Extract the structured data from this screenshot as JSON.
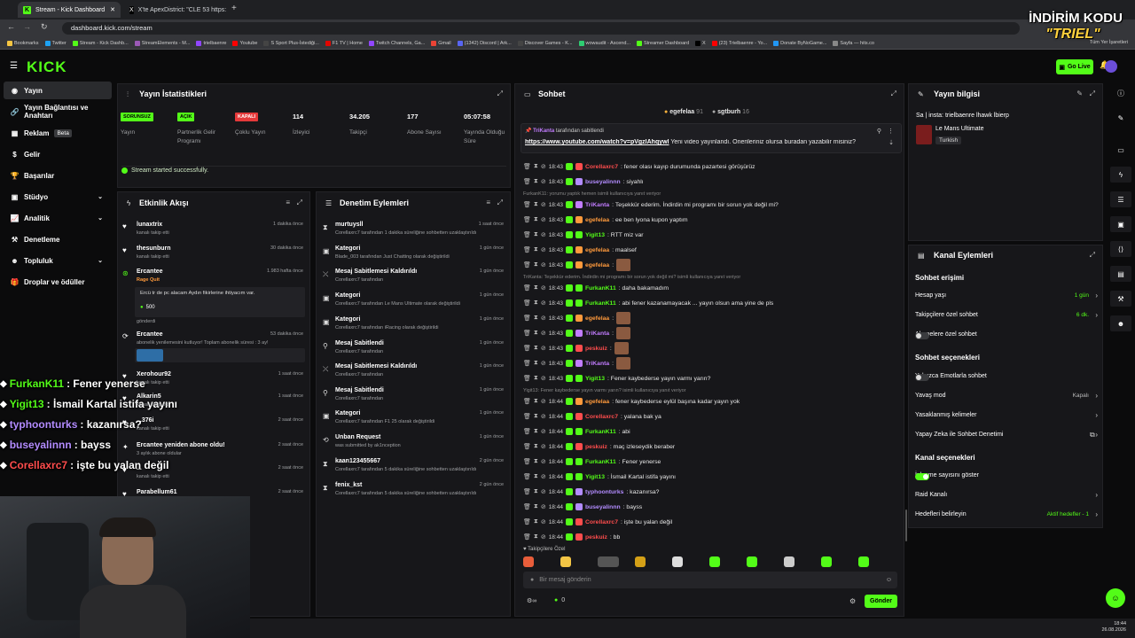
{
  "browser": {
    "tabs": [
      {
        "title": "Stream - Kick Dashboard",
        "icon": "kick-icon"
      },
      {
        "title": "X'te ApexDistrict: \"CLE 53 https:",
        "icon": "x-icon"
      }
    ],
    "url": "dashboard.kick.com/stream",
    "bookmarks": [
      "Bookmarks",
      "Twitter",
      "Stream - Kick Dashb...",
      "StreamElements - M...",
      "trielbaenre",
      "Youtube",
      "S Sport Plus-İstediği...",
      "F1 TV | Home",
      "Twitch Channels, Ga...",
      "Gmail",
      "(1342) Discord | Ark...",
      "Discover Games - K...",
      "wowaudit - Ascend...",
      "Streamer Dashboard",
      "X",
      "(23) Trielbaenre - Yo...",
      "Donate ByNoGame...",
      "Sayfa — hits.co"
    ],
    "all_bookmarks": "Tüm Yer İşaretleri"
  },
  "promo": {
    "line1": "İNDİRİM KODU",
    "line2": "\"TRIEL\""
  },
  "header": {
    "logo": "KICK",
    "golive": "Go Live"
  },
  "sidebar": {
    "items": [
      {
        "label": "Yayın",
        "icon": "broadcast-icon"
      },
      {
        "label": "Yayın Bağlantısı ve Anahtarı",
        "icon": "link-icon"
      },
      {
        "label": "Reklam",
        "badge": "Beta",
        "icon": "ad-icon"
      },
      {
        "label": "Gelir",
        "icon": "money-icon"
      },
      {
        "label": "Başarılar",
        "icon": "trophy-icon"
      },
      {
        "label": "Stüdyo",
        "icon": "studio-icon"
      },
      {
        "label": "Analitik",
        "icon": "chart-icon"
      },
      {
        "label": "Denetleme",
        "icon": "hammer-icon"
      },
      {
        "label": "Topluluk",
        "icon": "community-icon"
      },
      {
        "label": "Droplar ve ödüller",
        "icon": "gift-icon"
      }
    ]
  },
  "stats": {
    "title": "Yayın İstatistikleri",
    "items": [
      {
        "value": "SORUNSUZ",
        "label": "Yayın",
        "color": "#53fc18"
      },
      {
        "value": "AÇIK",
        "label": "Partnerlik Gelir Programı",
        "color": "#53fc18"
      },
      {
        "value": "KAPALI",
        "label": "Çoklu Yayın",
        "color": "#e5393a"
      },
      {
        "value": "114",
        "label": "İzleyici"
      },
      {
        "value": "34.205",
        "label": "Takipçi"
      },
      {
        "value": "177",
        "label": "Abone Sayısı"
      },
      {
        "value": "05:07:58",
        "label": "Yayında Olduğu Süre"
      }
    ],
    "success": "Stream started successfully."
  },
  "activity": {
    "title": "Etkinlik Akışı",
    "items": [
      {
        "name": "lunaxtrix",
        "sub": "kanalı takip etti",
        "time": "1 dakika önce"
      },
      {
        "name": "thesunburn",
        "sub": "kanalı takip etti",
        "time": "30 dakika önce"
      },
      {
        "name": "Ercantee",
        "sub": "Rage Quit",
        "time": "1.983 hafta önce",
        "msg": "Ercü tr de pc alacam Aydın fikirlerine ihtiyacım var.",
        "amount": "500",
        "sub2": "gönderdi"
      },
      {
        "name": "Ercantee",
        "sub": "abonelik yenilemesini kutluyor! Toplam abonelik süresi : 3 ay!",
        "time": "53 dakika önce"
      },
      {
        "name": "Xerohour92",
        "sub": "kanalı takip etti",
        "time": "1 saat önce"
      },
      {
        "name": "Alkarin5",
        "sub": "kanalı takip etti",
        "time": "1 saat önce"
      },
      {
        "name": "...376i",
        "sub": "kanalı takip etti",
        "time": "2 saat önce"
      },
      {
        "name": "Ercantee yeniden abone oldu!",
        "sub": "3 aylık abone oldular",
        "time": "2 saat önce"
      },
      {
        "name": "...",
        "sub": "kanalı takip etti",
        "time": "2 saat önce"
      },
      {
        "name": "Parabellum61",
        "sub": "",
        "time": "2 saat önce"
      }
    ]
  },
  "moderation": {
    "title": "Denetim Eylemleri",
    "items": [
      {
        "name": "murtuysll",
        "sub": "Corellaxrc7 tarafından 1 dakika süreliğine sohbetten uzaklaştırıldı",
        "time": "1 saat önce",
        "icon": "hourglass-icon"
      },
      {
        "name": "Kategori",
        "sub": "Blade_003 tarafından Just Chatting olarak değiştirildi",
        "time": "1 gün önce",
        "icon": "category-icon"
      },
      {
        "name": "Mesaj Sabitlemesi Kaldırıldı",
        "sub": "Corellaxrc7 tarafından",
        "time": "1 gün önce",
        "icon": "unpin-icon"
      },
      {
        "name": "Kategori",
        "sub": "Corellaxrc7 tarafından Le Mans Ultimate olarak değiştirildi",
        "time": "1 gün önce",
        "icon": "category-icon"
      },
      {
        "name": "Kategori",
        "sub": "Corellaxrc7 tarafından iRacing olarak değiştirildi",
        "time": "1 gün önce",
        "icon": "category-icon"
      },
      {
        "name": "Mesaj Sabitlendi",
        "sub": "Corellaxrc7 tarafından",
        "time": "1 gün önce",
        "icon": "pin-icon"
      },
      {
        "name": "Mesaj Sabitlemesi Kaldırıldı",
        "sub": "Corellaxrc7 tarafından",
        "time": "1 gün önce",
        "icon": "unpin-icon"
      },
      {
        "name": "Mesaj Sabitlendi",
        "sub": "Corellaxrc7 tarafından",
        "time": "1 gün önce",
        "icon": "pin-icon"
      },
      {
        "name": "Kategori",
        "sub": "Corellaxrc7 tarafından F1 25 olarak değiştirildi",
        "time": "1 gün önce",
        "icon": "category-icon"
      },
      {
        "name": "Unban Request",
        "sub": "was submitted by ak1nception",
        "time": "1 gün önce",
        "icon": "refresh-icon"
      },
      {
        "name": "kaan123455667",
        "sub": "Corellaxrc7 tarafından 5 dakika süreliğine sohbetten uzaklaştırıldı",
        "time": "2 gün önce",
        "icon": "hourglass-icon"
      },
      {
        "name": "fenix_kst",
        "sub": "Corellaxrc7 tarafından 5 dakika süreliğine sohbetten uzaklaştırıldı",
        "time": "2 gün önce",
        "icon": "hourglass-icon"
      }
    ]
  },
  "chat": {
    "title": "Sohbet",
    "top_users": [
      {
        "name": "egefelaa",
        "count": "91"
      },
      {
        "name": "sgtburh",
        "count": "16"
      }
    ],
    "pinned": {
      "by": "TriKanta",
      "label": "tarafından sabitlendi",
      "link": "https://www.youtube.com/watch?v=pVgzlAhqywl",
      "text": " Yeni video yayınlandı. Önerileriniz olursa buradan yazabilir misiniz?"
    },
    "messages": [
      {
        "time": "18:43",
        "user": "Corellaxrc7",
        "color": "#ff4d4d",
        "text": ": fener olası kayıp durumunda pazartesi görüşürüz"
      },
      {
        "time": "18:43",
        "user": "buseyalinnn",
        "color": "#b38cff",
        "text": ": siyahlı"
      },
      {
        "reply": "FurkanK11: yorumu yaptık hemen isimli kullanıcıya yanıt veriyor"
      },
      {
        "time": "18:43",
        "user": "TriKanta",
        "color": "#c27cff",
        "text": ": Teşekkür ederim. İndirdin mi programı bir sorun yok değil mi?"
      },
      {
        "time": "18:43",
        "user": "egefelaa",
        "color": "#ff9a3c",
        "text": ": ee ben lyona kupon yaptım"
      },
      {
        "time": "18:43",
        "user": "Yigit13",
        "color": "#53fc18",
        "text": ": RTT miz var"
      },
      {
        "time": "18:43",
        "user": "egefelaa",
        "color": "#ff9a3c",
        "text": ": maalsef"
      },
      {
        "time": "18:43",
        "user": "egefelaa",
        "color": "#ff9a3c",
        "text": ":",
        "emote": true
      },
      {
        "reply": "TriKanta: Teşekkür ederim. İndirdin mi programı bir sorun yok değil mi? isimli kullanıcıya yanıt veriyor"
      },
      {
        "time": "18:43",
        "user": "FurkanK11",
        "color": "#53fc18",
        "text": ": daha bakamadım"
      },
      {
        "time": "18:43",
        "user": "FurkanK11",
        "color": "#53fc18",
        "text": ": abi fener kazanamayacak ... yayın olsun ama yine de pls"
      },
      {
        "time": "18:43",
        "user": "egefelaa",
        "color": "#ff9a3c",
        "text": ":",
        "emote": true
      },
      {
        "time": "18:43",
        "user": "TriKanta",
        "color": "#c27cff",
        "text": ":",
        "emote": true
      },
      {
        "time": "18:43",
        "user": "peskuiz",
        "color": "#ff4d4d",
        "text": ":",
        "emote": true
      },
      {
        "time": "18:43",
        "user": "TriKanta",
        "color": "#c27cff",
        "text": ":",
        "emote": true
      },
      {
        "time": "18:43",
        "user": "Yigit13",
        "color": "#53fc18",
        "text": ": Fener kaybederse yayın varmı yarın?"
      },
      {
        "reply": "Yigit13: Fener kaybederse yayın varmı yarın? isimli kullanıcıya yanıt veriyor"
      },
      {
        "time": "18:44",
        "user": "egefelaa",
        "color": "#ff9a3c",
        "text": ": fener kaybederse eylül başına kadar yayın yok"
      },
      {
        "time": "18:44",
        "user": "Corellaxrc7",
        "color": "#ff4d4d",
        "text": ": yalana bak ya"
      },
      {
        "time": "18:44",
        "user": "FurkanK11",
        "color": "#53fc18",
        "text": ": abi"
      },
      {
        "time": "18:44",
        "user": "peskuiz",
        "color": "#ff4d4d",
        "text": ": maç izleseydik beraber"
      },
      {
        "time": "18:44",
        "user": "FurkanK11",
        "color": "#53fc18",
        "text": ": Fener yenerse"
      },
      {
        "time": "18:44",
        "user": "Yigit13",
        "color": "#53fc18",
        "text": ": İsmail Kartal istifa yayını"
      },
      {
        "time": "18:44",
        "user": "typhoonturks",
        "color": "#b38cff",
        "text": ": kazanırsa?"
      },
      {
        "time": "18:44",
        "user": "buseyalinnn",
        "color": "#b38cff",
        "text": ": bayss"
      },
      {
        "time": "18:44",
        "user": "Corellaxrc7",
        "color": "#ff4d4d",
        "text": ": işte bu yalan değil"
      },
      {
        "time": "18:44",
        "user": "peskuiz",
        "color": "#ff4d4d",
        "text": ": bb"
      }
    ],
    "followers_only": "Takipçilere Özel",
    "placeholder": "Bir mesaj gönderin",
    "points": "0",
    "send": "Gönder"
  },
  "overlay_chat": [
    {
      "user": "FurkanK11",
      "color": "#53fc18",
      "text": " : Fener yenerse"
    },
    {
      "user": "Yigit13",
      "color": "#53fc18",
      "text": " : İsmail Kartal istifa yayını"
    },
    {
      "user": "typhoonturks",
      "color": "#b38cff",
      "text": " : kazanırsa?"
    },
    {
      "user": "buseyalinnn",
      "color": "#b38cff",
      "text": " : bayss"
    },
    {
      "user": "Corellaxrc7",
      "color": "#ff4d4d",
      "text": " : işte bu yalan değil"
    }
  ],
  "streaminfo": {
    "title": "Yayın bilgisi",
    "stream_title": "Sa | insta: trielbaenre lhawk lbierp",
    "category": "Le Mans Ultimate",
    "language": "Turkish"
  },
  "channel": {
    "title": "Kanal Eylemleri",
    "sec1": "Sohbet erişimi",
    "rows1": [
      {
        "label": "Hesap yaşı",
        "value": "1 gün"
      },
      {
        "label": "Takipçilere özel sohbet",
        "value": "6 dk."
      },
      {
        "label": "Abonelere özel sohbet",
        "toggle": false
      }
    ],
    "sec2": "Sohbet seçenekleri",
    "rows2": [
      {
        "label": "Yalnızca Emotlarla sohbet",
        "toggle": false
      },
      {
        "label": "Yavaş mod",
        "value": "Kapalı"
      },
      {
        "label": "Yasaklanmış kelimeler"
      },
      {
        "label": "Yapay Zeka ile Sohbet Denetimi"
      }
    ],
    "sec3": "Kanal seçenekleri",
    "rows3": [
      {
        "label": "İzlenme sayısını göster",
        "toggle": true
      },
      {
        "label": "Raid Kanalı"
      },
      {
        "label": "Hedefleri belirleyin",
        "value": "Aktif hedefler - 1"
      }
    ]
  },
  "clock": {
    "time": "18:44",
    "date": "26.08.2026"
  }
}
